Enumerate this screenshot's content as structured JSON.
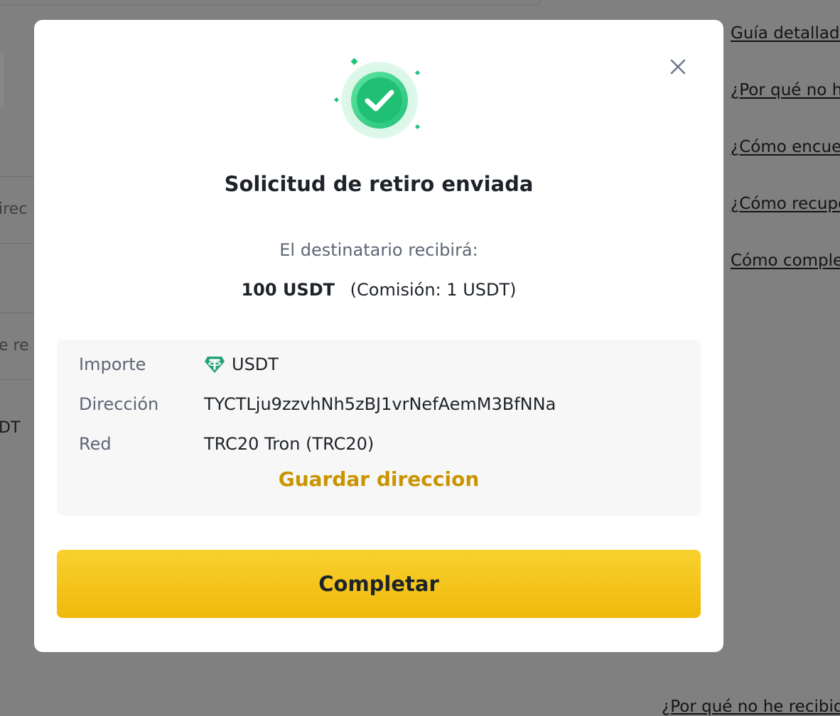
{
  "background": {
    "fragments": [
      "irec",
      "e re",
      "DT"
    ],
    "help_links": [
      "Guía detallada",
      "¿Por qué no he",
      "¿Cómo encuentro",
      "¿Cómo recupero",
      "Cómo completar"
    ],
    "bottom_link": "¿Por qué no he recibido"
  },
  "modal": {
    "close_icon": "close-icon",
    "success_icon": "check-circle-icon",
    "title": "Solicitud de retiro enviada",
    "subtitle": "El destinatario recibirá:",
    "amount": "100 USDT",
    "fee": "(Comisión: 1 USDT)",
    "details": {
      "amount_label": "Importe",
      "amount_value": "USDT",
      "token_icon": "tether-icon",
      "address_label": "Dirección",
      "address_value": "TYCTLju9zzvhNh5zBJ1vrNefAemM3BfNNa",
      "network_label": "Red",
      "network_value": "TRC20 Tron (TRC20)"
    },
    "save_address_label": "Guardar direccion",
    "complete_button_label": "Completar"
  },
  "colors": {
    "accent": "#f0b90b",
    "accent_text": "#c99400",
    "success": "#20c47a",
    "tether": "#26a17b",
    "overlay": "#808080"
  }
}
